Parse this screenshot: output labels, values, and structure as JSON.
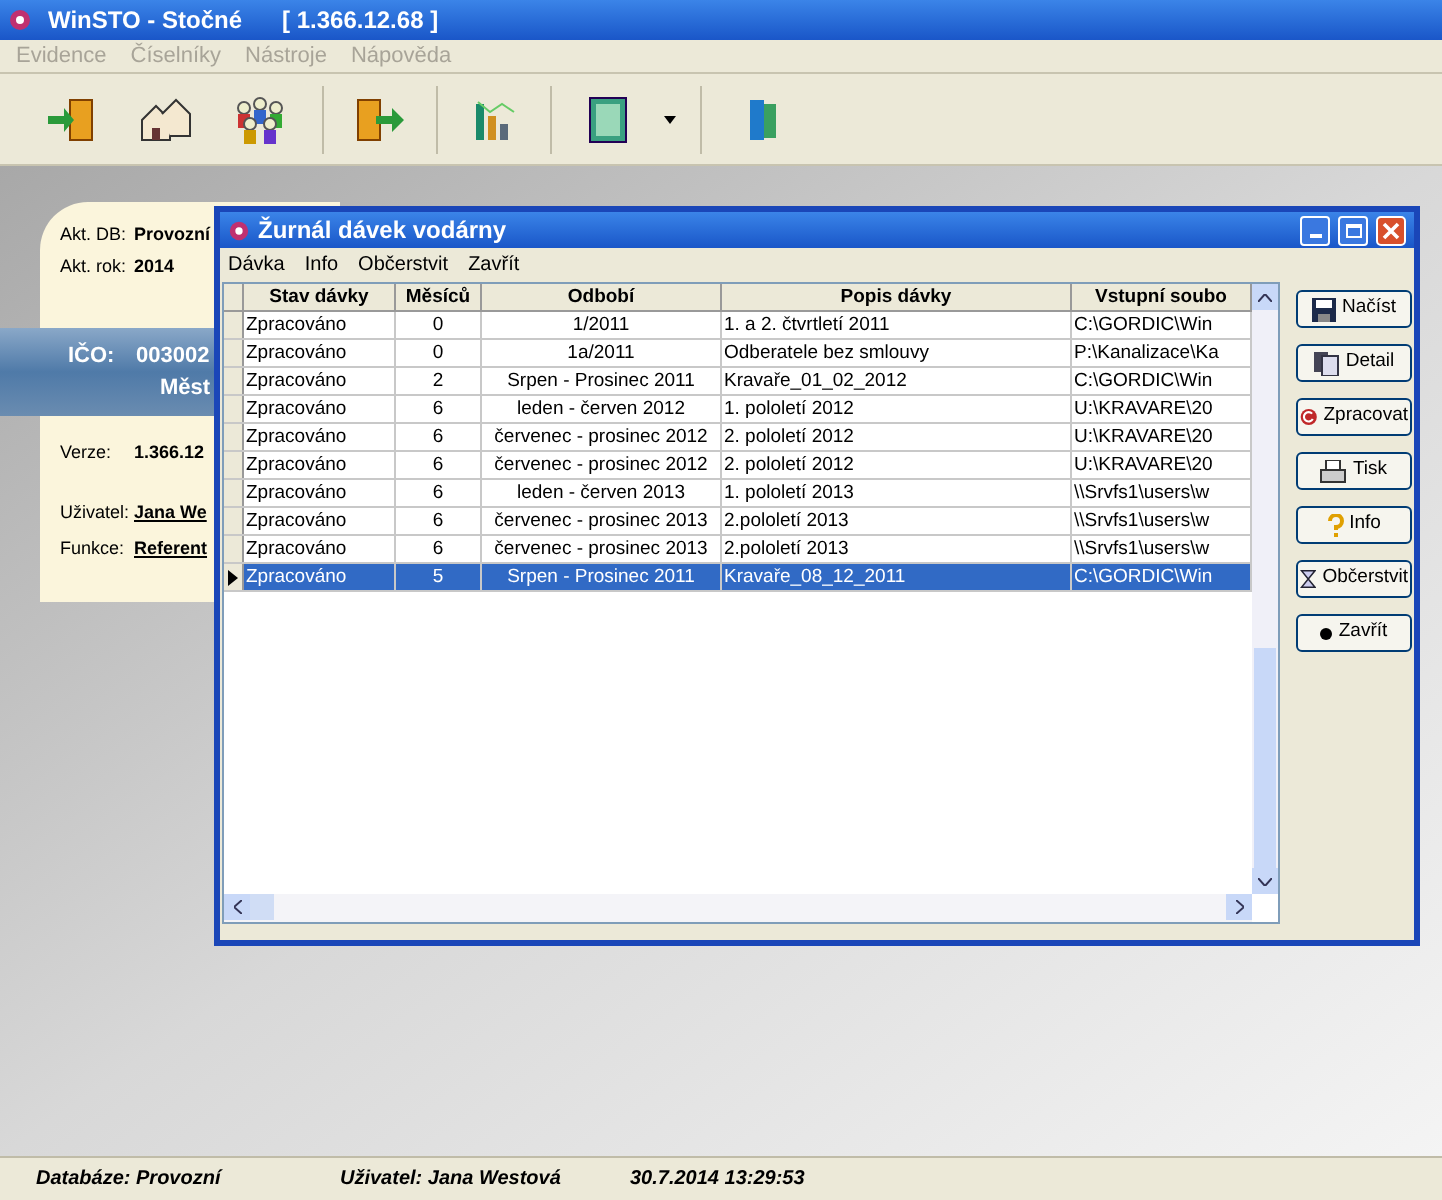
{
  "window": {
    "title": "WinSTO - Stočné",
    "version": "[ 1.366.12.68 ]"
  },
  "menu": [
    {
      "label": "Evidence",
      "disabled": true
    },
    {
      "label": "Číselníky",
      "disabled": true
    },
    {
      "label": "Nástroje",
      "disabled": true
    },
    {
      "label": "Nápověda",
      "disabled": true
    }
  ],
  "info_panel": {
    "db_label": "Akt. DB:",
    "db_value": "Provozní",
    "year_label": "Akt. rok:",
    "year_value": "2014",
    "ico_label": "IČO:",
    "ico_value": "003002",
    "org_name": "Měst",
    "version_label": "Verze:",
    "version_value": "1.366.12",
    "user_label": "Uživatel:",
    "user_value": "Jana We",
    "role_label": "Funkce:",
    "role_value": "Referent"
  },
  "dialog": {
    "title": "Žurnál dávek vodárny",
    "menu": [
      "Dávka",
      "Info",
      "Občerstvit",
      "Zavřít"
    ],
    "columns": [
      "Stav dávky",
      "Měsíců",
      "Odbobí",
      "Popis dávky",
      "Vstupní soubo"
    ],
    "rows": [
      {
        "cells": [
          "Zpracováno",
          "0",
          "1/2011",
          "1. a 2. čtvrtletí 2011",
          "C:\\GORDIC\\Win"
        ],
        "selected": false
      },
      {
        "cells": [
          "Zpracováno",
          "0",
          "1a/2011",
          "Odberatele bez smlouvy",
          "P:\\Kanalizace\\Ka"
        ],
        "selected": false
      },
      {
        "cells": [
          "Zpracováno",
          "2",
          "Srpen - Prosinec 2011",
          "Kravaře_01_02_2012",
          "C:\\GORDIC\\Win"
        ],
        "selected": false
      },
      {
        "cells": [
          "Zpracováno",
          "6",
          "leden - červen 2012",
          "1. pololetí 2012",
          "U:\\KRAVARE\\20"
        ],
        "selected": false
      },
      {
        "cells": [
          "Zpracováno",
          "6",
          "červenec - prosinec 2012",
          "2. pololetí 2012",
          "U:\\KRAVARE\\20"
        ],
        "selected": false
      },
      {
        "cells": [
          "Zpracováno",
          "6",
          "červenec - prosinec 2012",
          "2. pololetí 2012",
          "U:\\KRAVARE\\20"
        ],
        "selected": false
      },
      {
        "cells": [
          "Zpracováno",
          "6",
          "leden - červen 2013",
          "1. pololetí 2013",
          "\\\\Srvfs1\\users\\w"
        ],
        "selected": false
      },
      {
        "cells": [
          "Zpracováno",
          "6",
          "červenec - prosinec 2013",
          "2.pololetí 2013",
          "\\\\Srvfs1\\users\\w"
        ],
        "selected": false
      },
      {
        "cells": [
          "Zpracováno",
          "6",
          "červenec - prosinec 2013",
          "2.pololetí 2013",
          "\\\\Srvfs1\\users\\w"
        ],
        "selected": false
      },
      {
        "cells": [
          "Zpracováno",
          "5",
          "Srpen - Prosinec 2011",
          "Kravaře_08_12_2011",
          "C:\\GORDIC\\Win"
        ],
        "selected": true
      }
    ],
    "buttons": [
      {
        "label": "Načíst",
        "kind": "save"
      },
      {
        "label": "Detail",
        "kind": "detail"
      },
      {
        "label": "Zpracovat",
        "kind": "process"
      },
      {
        "label": "Tisk",
        "kind": "print"
      },
      {
        "label": "Info",
        "kind": "info"
      },
      {
        "label": "Občerstvit",
        "kind": "refresh"
      },
      {
        "label": "Zavřít",
        "kind": "close"
      }
    ]
  },
  "status_bar": [
    "Databáze: Provozní",
    "Uživatel: Jana Westová",
    "30.7.2014  13:29:53"
  ]
}
